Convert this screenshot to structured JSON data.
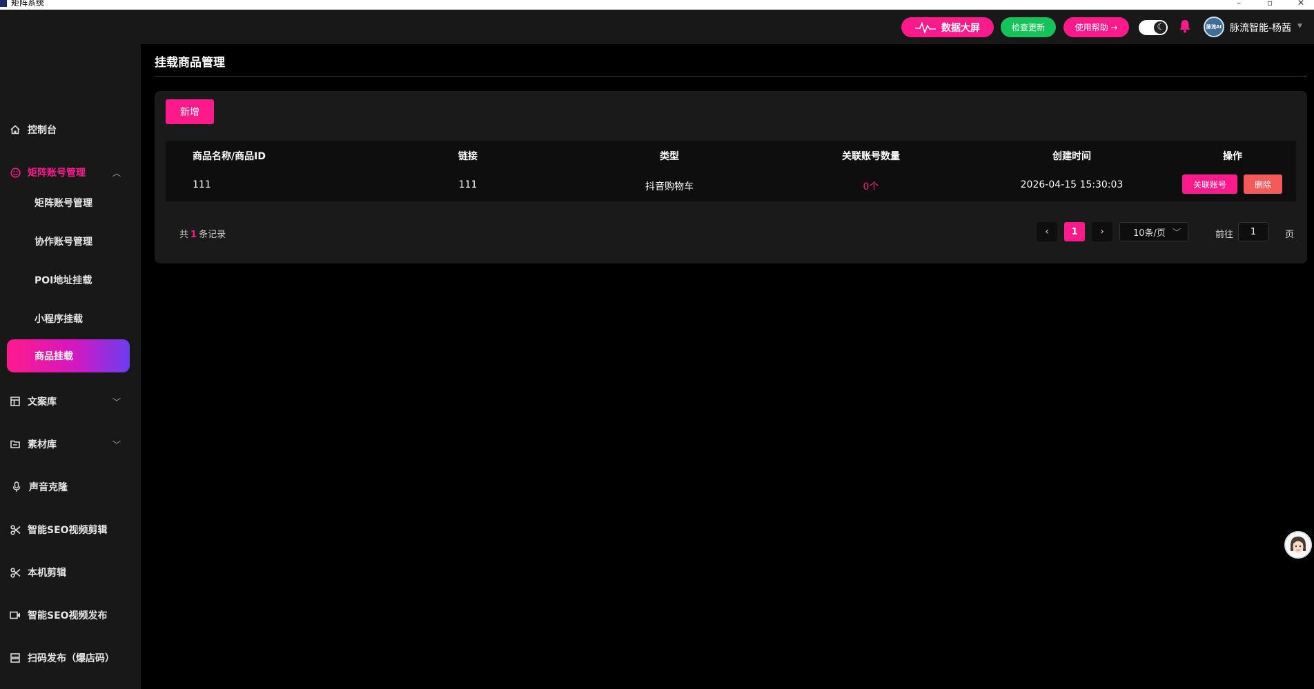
{
  "window": {
    "title": "矩阵系统",
    "minimize": "–",
    "maximize": "▫",
    "close": "✕"
  },
  "header": {
    "dashboard_label": "数据大屏",
    "check_update_label": "检查更新",
    "help_label": "使用帮助 →",
    "avatar_text": "脉流AI",
    "username": "脉流智能-杨茜",
    "theme_toggle": "dark",
    "accent_color": "#ff1a8c",
    "check_color": "#15c35a"
  },
  "sidebar": {
    "items": [
      {
        "label": "控制台",
        "icon": "home-icon"
      },
      {
        "label": "矩阵账号管理",
        "icon": "smile-icon",
        "expanded": true
      },
      {
        "label": "文案库",
        "icon": "layout-icon"
      },
      {
        "label": "素材库",
        "icon": "folder-icon"
      },
      {
        "label": "声音克隆",
        "icon": "mic-icon"
      },
      {
        "label": "智能SEO视频剪辑",
        "icon": "scissors-icon"
      },
      {
        "label": "本机剪辑",
        "icon": "scissors-icon"
      },
      {
        "label": "智能SEO视频发布",
        "icon": "video-icon"
      },
      {
        "label": "扫码发布（爆店码）",
        "icon": "qrcode-icon"
      }
    ],
    "sub_items": [
      {
        "label": "矩阵账号管理"
      },
      {
        "label": "协作账号管理"
      },
      {
        "label": "POI地址挂载"
      },
      {
        "label": "小程序挂载"
      },
      {
        "label": "商品挂载",
        "active": true
      }
    ]
  },
  "main": {
    "title": "挂载商品管理",
    "add_label": "新增",
    "table": {
      "headers": [
        "商品名称/商品ID",
        "链接",
        "类型",
        "关联账号数量",
        "创建时间",
        "操作"
      ],
      "rows": [
        {
          "name": "111",
          "link": "111",
          "type": "抖音购物车",
          "count": "0个",
          "created": "2026-04-15 15:30:03",
          "action_link": "关联账号",
          "action_delete": "删除"
        }
      ]
    },
    "pagination": {
      "total_prefix": "共",
      "total": "1",
      "total_suffix": "条记录",
      "current_page": "1",
      "page_size": "10条/页",
      "goto_label": "前往",
      "goto_value": "1",
      "page_unit": "页"
    }
  }
}
